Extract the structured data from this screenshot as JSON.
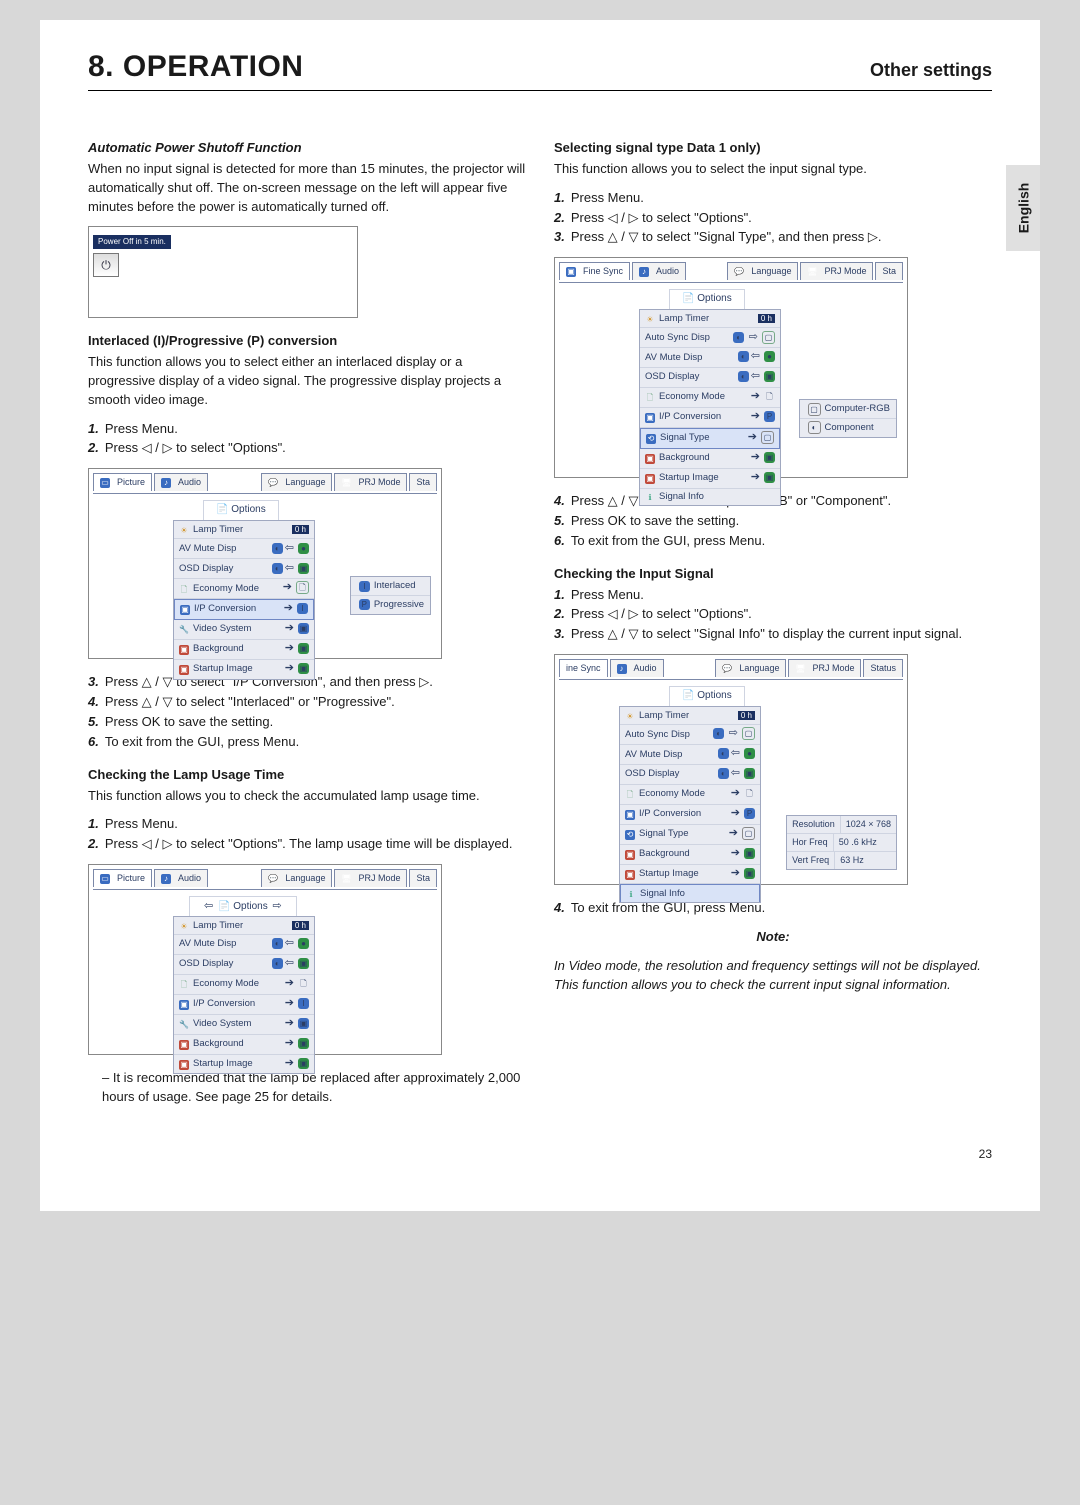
{
  "header": {
    "chapter": "8. OPERATION",
    "section": "Other settings"
  },
  "language_tab": "English",
  "left": {
    "h1": "Automatic Power Shutoff Function",
    "p1": "When no input signal is detected for more than 15 minutes, the projector will automatically shut off. The on-screen message on the left will appear five minutes before the power is automatically turned off.",
    "fig1_label": "Power Off in 5 min.",
    "h2": "Interlaced (I)/Progressive (P) conversion",
    "p2": "This function allows you to select either an interlaced display or a progressive display of a video signal. The progressive display projects a smooth video image.",
    "s2": [
      "Press Menu.",
      "Press ◁ / ▷ to select \"Options\"."
    ],
    "fig2": {
      "tabs_left": [
        "Picture",
        "Audio"
      ],
      "tabs_right": [
        "Language",
        "PRJ Mode",
        "Sta"
      ],
      "options_header": "Options",
      "items": [
        "Lamp Timer",
        "AV Mute Disp",
        "OSD Display",
        "Economy Mode",
        "I/P Conversion",
        "Video System",
        "Background",
        "Startup Image"
      ],
      "selected": "I/P Conversion",
      "popup": [
        "Interlaced",
        "Progressive"
      ],
      "lamp_value": "0 h"
    },
    "s2b": [
      "Press △ / ▽ to select \"I/P Conversion\", and then press ▷.",
      "Press △ / ▽ to select \"Interlaced\" or \"Progressive\".",
      "Press OK to save the setting.",
      "To exit from the GUI, press Menu."
    ],
    "h3": "Checking the Lamp Usage Time",
    "p3": "This function allows you to check the accumulated lamp usage time.",
    "s3": [
      "Press Menu.",
      "Press ◁ / ▷ to select \"Options\". The lamp usage time will be displayed."
    ],
    "fig3": {
      "tabs_left": [
        "Picture",
        "Audio"
      ],
      "tabs_right": [
        "Language",
        "PRJ Mode",
        "Sta"
      ],
      "options_header": "Options",
      "items": [
        "Lamp Timer",
        "AV Mute Disp",
        "OSD Display",
        "Economy Mode",
        "I/P Conversion",
        "Video System",
        "Background",
        "Startup Image"
      ],
      "lamp_value": "0 h"
    },
    "note_after_fig3": "–   It is recommended that the lamp be replaced after approximately 2,000 hours of usage. See page 25 for details."
  },
  "right": {
    "h1": "Selecting signal type Data 1 only)",
    "p1": "This function allows you to select the input signal type.",
    "s1": [
      "Press Menu.",
      "Press ◁ / ▷ to select \"Options\".",
      "Press △ / ▽ to select \"Signal Type\", and then press ▷."
    ],
    "fig1": {
      "tabs_left": [
        "Fine Sync",
        "Audio"
      ],
      "tabs_right": [
        "Language",
        "PRJ Mode",
        "Sta"
      ],
      "options_header": "Options",
      "items": [
        "Lamp Timer",
        "Auto Sync Disp",
        "AV Mute Disp",
        "OSD Display",
        "Economy Mode",
        "I/P Conversion",
        "Signal Type",
        "Background",
        "Startup Image",
        "Signal Info"
      ],
      "selected": "Signal Type",
      "popup": [
        "Computer-RGB",
        "Component"
      ],
      "lamp_value": "0 h"
    },
    "s1b": [
      "Press △ / ▽ to select \"Computer/RGB\" or \"Component\".",
      "Press OK to save the setting.",
      "To exit from the GUI, press Menu."
    ],
    "h2": "Checking the Input Signal",
    "s2": [
      "Press Menu.",
      "Press ◁ / ▷ to select \"Options\".",
      "Press △ / ▽ to select \"Signal Info\" to display the current input signal."
    ],
    "fig2": {
      "tabs_left": [
        "ine Sync",
        "Audio"
      ],
      "tabs_right": [
        "Language",
        "PRJ Mode",
        "Status"
      ],
      "options_header": "Options",
      "items": [
        "Lamp Timer",
        "Auto Sync Disp",
        "AV Mute Disp",
        "OSD Display",
        "Economy Mode",
        "I/P Conversion",
        "Signal Type",
        "Background",
        "Startup Image",
        "Signal Info"
      ],
      "selected": "Signal Info",
      "info": {
        "Resolution": "1024 × 768",
        "Hor Freq": "50 .6 kHz",
        "Vert Freq": "63   Hz"
      },
      "lamp_value": "0 h"
    },
    "s2b": [
      "To exit from the GUI, press Menu."
    ],
    "note_label": "Note:",
    "note": "In Video mode, the resolution and frequency settings will not be displayed. This function allows you to check the current input signal information."
  },
  "page_number": "23"
}
